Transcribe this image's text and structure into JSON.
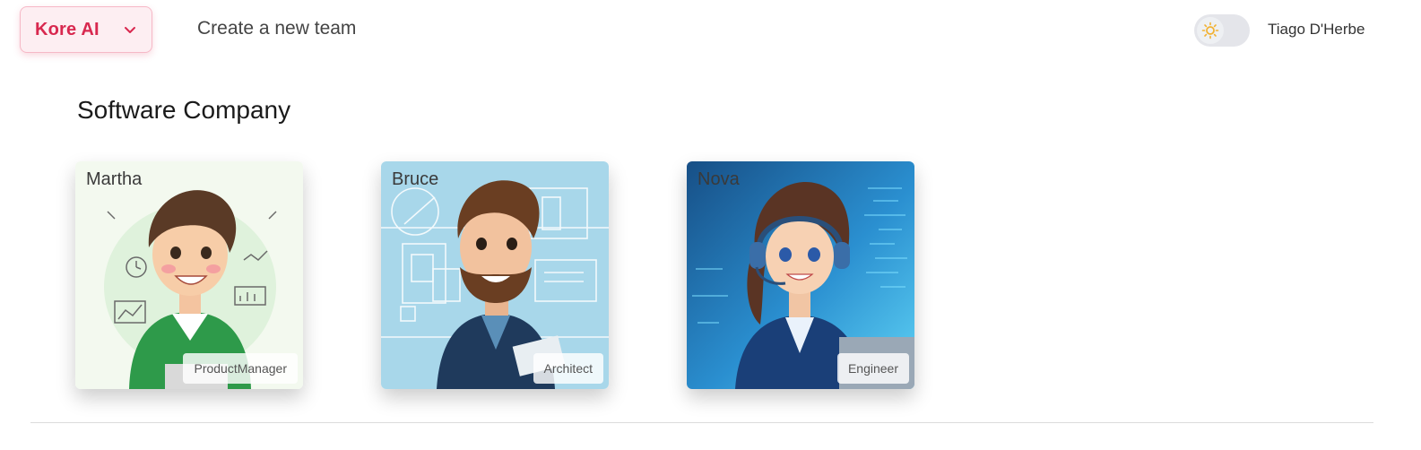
{
  "header": {
    "org_name": "Kore AI",
    "org_chevron_icon": "chevron-down-icon",
    "create_team_label": "Create a new team",
    "theme_toggle_icon": "sun-icon",
    "user_name": "Tiago D'Herbe"
  },
  "team": {
    "title": "Software Company",
    "members": [
      {
        "name": "Martha",
        "role": "ProductManager",
        "background": "#f3f9ef"
      },
      {
        "name": "Bruce",
        "role": "Architect",
        "background": "#a8d7ea"
      },
      {
        "name": "Nova",
        "role": "Engineer",
        "background": "#1f6fb0"
      }
    ]
  },
  "colors": {
    "accent": "#d8284f",
    "accent_bg": "#fdeef2",
    "toggle_sun": "#f2b233"
  }
}
